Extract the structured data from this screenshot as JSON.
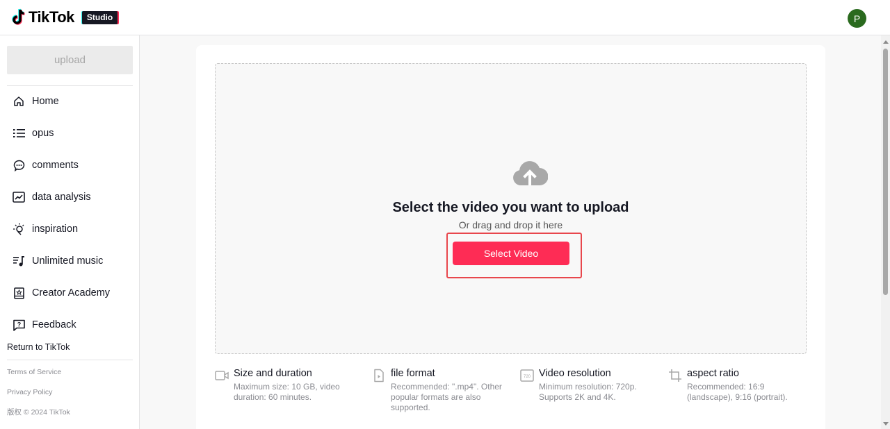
{
  "header": {
    "logo_text": "TikTok",
    "badge": "Studio",
    "avatar_initial": "P",
    "avatar_color": "#2a6a1e"
  },
  "sidebar": {
    "upload_label": "upload",
    "items": [
      {
        "label": "Home",
        "icon": "home-icon"
      },
      {
        "label": "opus",
        "icon": "list-icon"
      },
      {
        "label": "comments",
        "icon": "comment-icon"
      },
      {
        "label": "data analysis",
        "icon": "chart-icon"
      },
      {
        "label": "inspiration",
        "icon": "lightbulb-icon"
      },
      {
        "label": "Unlimited music",
        "icon": "music-list-icon"
      },
      {
        "label": "Creator Academy",
        "icon": "academy-book-icon"
      },
      {
        "label": "Feedback",
        "icon": "feedback-icon"
      }
    ],
    "return_label": "Return to TikTok",
    "footer": {
      "terms": "Terms of Service",
      "privacy": "Privacy Policy",
      "copyright": "版权 © 2024 TikTok"
    }
  },
  "upload": {
    "title": "Select the video you want to upload",
    "subtitle": "Or drag and drop it here",
    "button_label": "Select Video",
    "accent_color": "#fe2c55"
  },
  "info": [
    {
      "title": "Size and duration",
      "desc": "Maximum size: 10 GB, video duration: 60 minutes.",
      "icon": "video-camera-icon"
    },
    {
      "title": "file format",
      "desc": "Recommended: \".mp4\". Other popular formats are also supported.",
      "icon": "file-icon"
    },
    {
      "title": "Video resolution",
      "desc": "Minimum resolution: 720p. Supports 2K and 4K.",
      "icon": "resolution-720-icon",
      "icon_text": "720"
    },
    {
      "title": "aspect ratio",
      "desc": "Recommended: 16:9 (landscape), 9:16 (portrait).",
      "icon": "crop-icon"
    }
  ]
}
